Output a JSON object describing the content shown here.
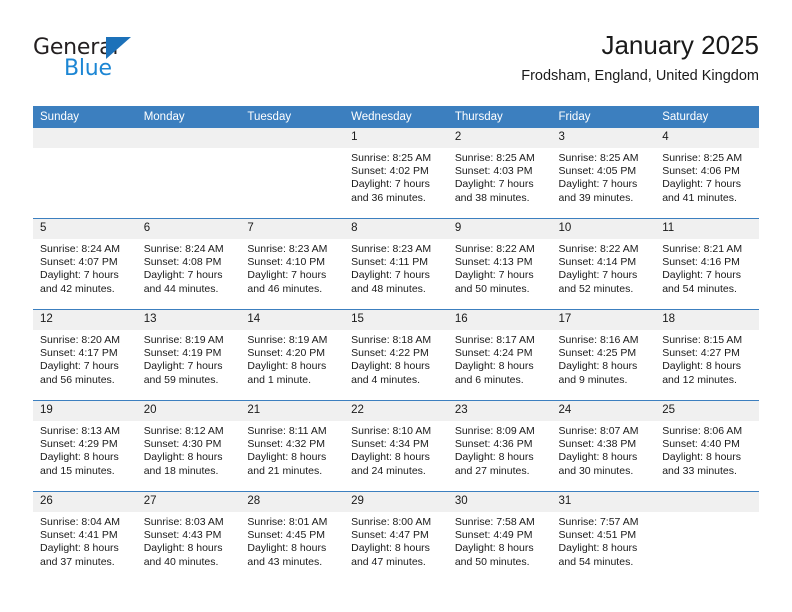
{
  "brand": {
    "name_part1": "General",
    "name_part2": "Blue",
    "triangle_icon": "triangle-icon",
    "color_dark": "#231f20",
    "color_blue": "#1c86d4"
  },
  "header": {
    "title": "January 2025",
    "subtitle": "Frodsham, England, United Kingdom"
  },
  "theme": {
    "header_row_bg": "#3c7fbf",
    "daynum_bg": "#f0f0f0",
    "row_divider": "#3c7fbf",
    "text": "#1a1a1a"
  },
  "calendar": {
    "weekday_headers": [
      "Sunday",
      "Monday",
      "Tuesday",
      "Wednesday",
      "Thursday",
      "Friday",
      "Saturday"
    ],
    "weeks": [
      [
        {
          "day": "",
          "empty": true
        },
        {
          "day": "",
          "empty": true
        },
        {
          "day": "",
          "empty": true
        },
        {
          "day": "1",
          "sunrise": "Sunrise: 8:25 AM",
          "sunset": "Sunset: 4:02 PM",
          "daylight": "Daylight: 7 hours and 36 minutes."
        },
        {
          "day": "2",
          "sunrise": "Sunrise: 8:25 AM",
          "sunset": "Sunset: 4:03 PM",
          "daylight": "Daylight: 7 hours and 38 minutes."
        },
        {
          "day": "3",
          "sunrise": "Sunrise: 8:25 AM",
          "sunset": "Sunset: 4:05 PM",
          "daylight": "Daylight: 7 hours and 39 minutes."
        },
        {
          "day": "4",
          "sunrise": "Sunrise: 8:25 AM",
          "sunset": "Sunset: 4:06 PM",
          "daylight": "Daylight: 7 hours and 41 minutes."
        }
      ],
      [
        {
          "day": "5",
          "sunrise": "Sunrise: 8:24 AM",
          "sunset": "Sunset: 4:07 PM",
          "daylight": "Daylight: 7 hours and 42 minutes."
        },
        {
          "day": "6",
          "sunrise": "Sunrise: 8:24 AM",
          "sunset": "Sunset: 4:08 PM",
          "daylight": "Daylight: 7 hours and 44 minutes."
        },
        {
          "day": "7",
          "sunrise": "Sunrise: 8:23 AM",
          "sunset": "Sunset: 4:10 PM",
          "daylight": "Daylight: 7 hours and 46 minutes."
        },
        {
          "day": "8",
          "sunrise": "Sunrise: 8:23 AM",
          "sunset": "Sunset: 4:11 PM",
          "daylight": "Daylight: 7 hours and 48 minutes."
        },
        {
          "day": "9",
          "sunrise": "Sunrise: 8:22 AM",
          "sunset": "Sunset: 4:13 PM",
          "daylight": "Daylight: 7 hours and 50 minutes."
        },
        {
          "day": "10",
          "sunrise": "Sunrise: 8:22 AM",
          "sunset": "Sunset: 4:14 PM",
          "daylight": "Daylight: 7 hours and 52 minutes."
        },
        {
          "day": "11",
          "sunrise": "Sunrise: 8:21 AM",
          "sunset": "Sunset: 4:16 PM",
          "daylight": "Daylight: 7 hours and 54 minutes."
        }
      ],
      [
        {
          "day": "12",
          "sunrise": "Sunrise: 8:20 AM",
          "sunset": "Sunset: 4:17 PM",
          "daylight": "Daylight: 7 hours and 56 minutes."
        },
        {
          "day": "13",
          "sunrise": "Sunrise: 8:19 AM",
          "sunset": "Sunset: 4:19 PM",
          "daylight": "Daylight: 7 hours and 59 minutes."
        },
        {
          "day": "14",
          "sunrise": "Sunrise: 8:19 AM",
          "sunset": "Sunset: 4:20 PM",
          "daylight": "Daylight: 8 hours and 1 minute."
        },
        {
          "day": "15",
          "sunrise": "Sunrise: 8:18 AM",
          "sunset": "Sunset: 4:22 PM",
          "daylight": "Daylight: 8 hours and 4 minutes."
        },
        {
          "day": "16",
          "sunrise": "Sunrise: 8:17 AM",
          "sunset": "Sunset: 4:24 PM",
          "daylight": "Daylight: 8 hours and 6 minutes."
        },
        {
          "day": "17",
          "sunrise": "Sunrise: 8:16 AM",
          "sunset": "Sunset: 4:25 PM",
          "daylight": "Daylight: 8 hours and 9 minutes."
        },
        {
          "day": "18",
          "sunrise": "Sunrise: 8:15 AM",
          "sunset": "Sunset: 4:27 PM",
          "daylight": "Daylight: 8 hours and 12 minutes."
        }
      ],
      [
        {
          "day": "19",
          "sunrise": "Sunrise: 8:13 AM",
          "sunset": "Sunset: 4:29 PM",
          "daylight": "Daylight: 8 hours and 15 minutes."
        },
        {
          "day": "20",
          "sunrise": "Sunrise: 8:12 AM",
          "sunset": "Sunset: 4:30 PM",
          "daylight": "Daylight: 8 hours and 18 minutes."
        },
        {
          "day": "21",
          "sunrise": "Sunrise: 8:11 AM",
          "sunset": "Sunset: 4:32 PM",
          "daylight": "Daylight: 8 hours and 21 minutes."
        },
        {
          "day": "22",
          "sunrise": "Sunrise: 8:10 AM",
          "sunset": "Sunset: 4:34 PM",
          "daylight": "Daylight: 8 hours and 24 minutes."
        },
        {
          "day": "23",
          "sunrise": "Sunrise: 8:09 AM",
          "sunset": "Sunset: 4:36 PM",
          "daylight": "Daylight: 8 hours and 27 minutes."
        },
        {
          "day": "24",
          "sunrise": "Sunrise: 8:07 AM",
          "sunset": "Sunset: 4:38 PM",
          "daylight": "Daylight: 8 hours and 30 minutes."
        },
        {
          "day": "25",
          "sunrise": "Sunrise: 8:06 AM",
          "sunset": "Sunset: 4:40 PM",
          "daylight": "Daylight: 8 hours and 33 minutes."
        }
      ],
      [
        {
          "day": "26",
          "sunrise": "Sunrise: 8:04 AM",
          "sunset": "Sunset: 4:41 PM",
          "daylight": "Daylight: 8 hours and 37 minutes."
        },
        {
          "day": "27",
          "sunrise": "Sunrise: 8:03 AM",
          "sunset": "Sunset: 4:43 PM",
          "daylight": "Daylight: 8 hours and 40 minutes."
        },
        {
          "day": "28",
          "sunrise": "Sunrise: 8:01 AM",
          "sunset": "Sunset: 4:45 PM",
          "daylight": "Daylight: 8 hours and 43 minutes."
        },
        {
          "day": "29",
          "sunrise": "Sunrise: 8:00 AM",
          "sunset": "Sunset: 4:47 PM",
          "daylight": "Daylight: 8 hours and 47 minutes."
        },
        {
          "day": "30",
          "sunrise": "Sunrise: 7:58 AM",
          "sunset": "Sunset: 4:49 PM",
          "daylight": "Daylight: 8 hours and 50 minutes."
        },
        {
          "day": "31",
          "sunrise": "Sunrise: 7:57 AM",
          "sunset": "Sunset: 4:51 PM",
          "daylight": "Daylight: 8 hours and 54 minutes."
        },
        {
          "day": "",
          "empty": true
        }
      ]
    ]
  }
}
